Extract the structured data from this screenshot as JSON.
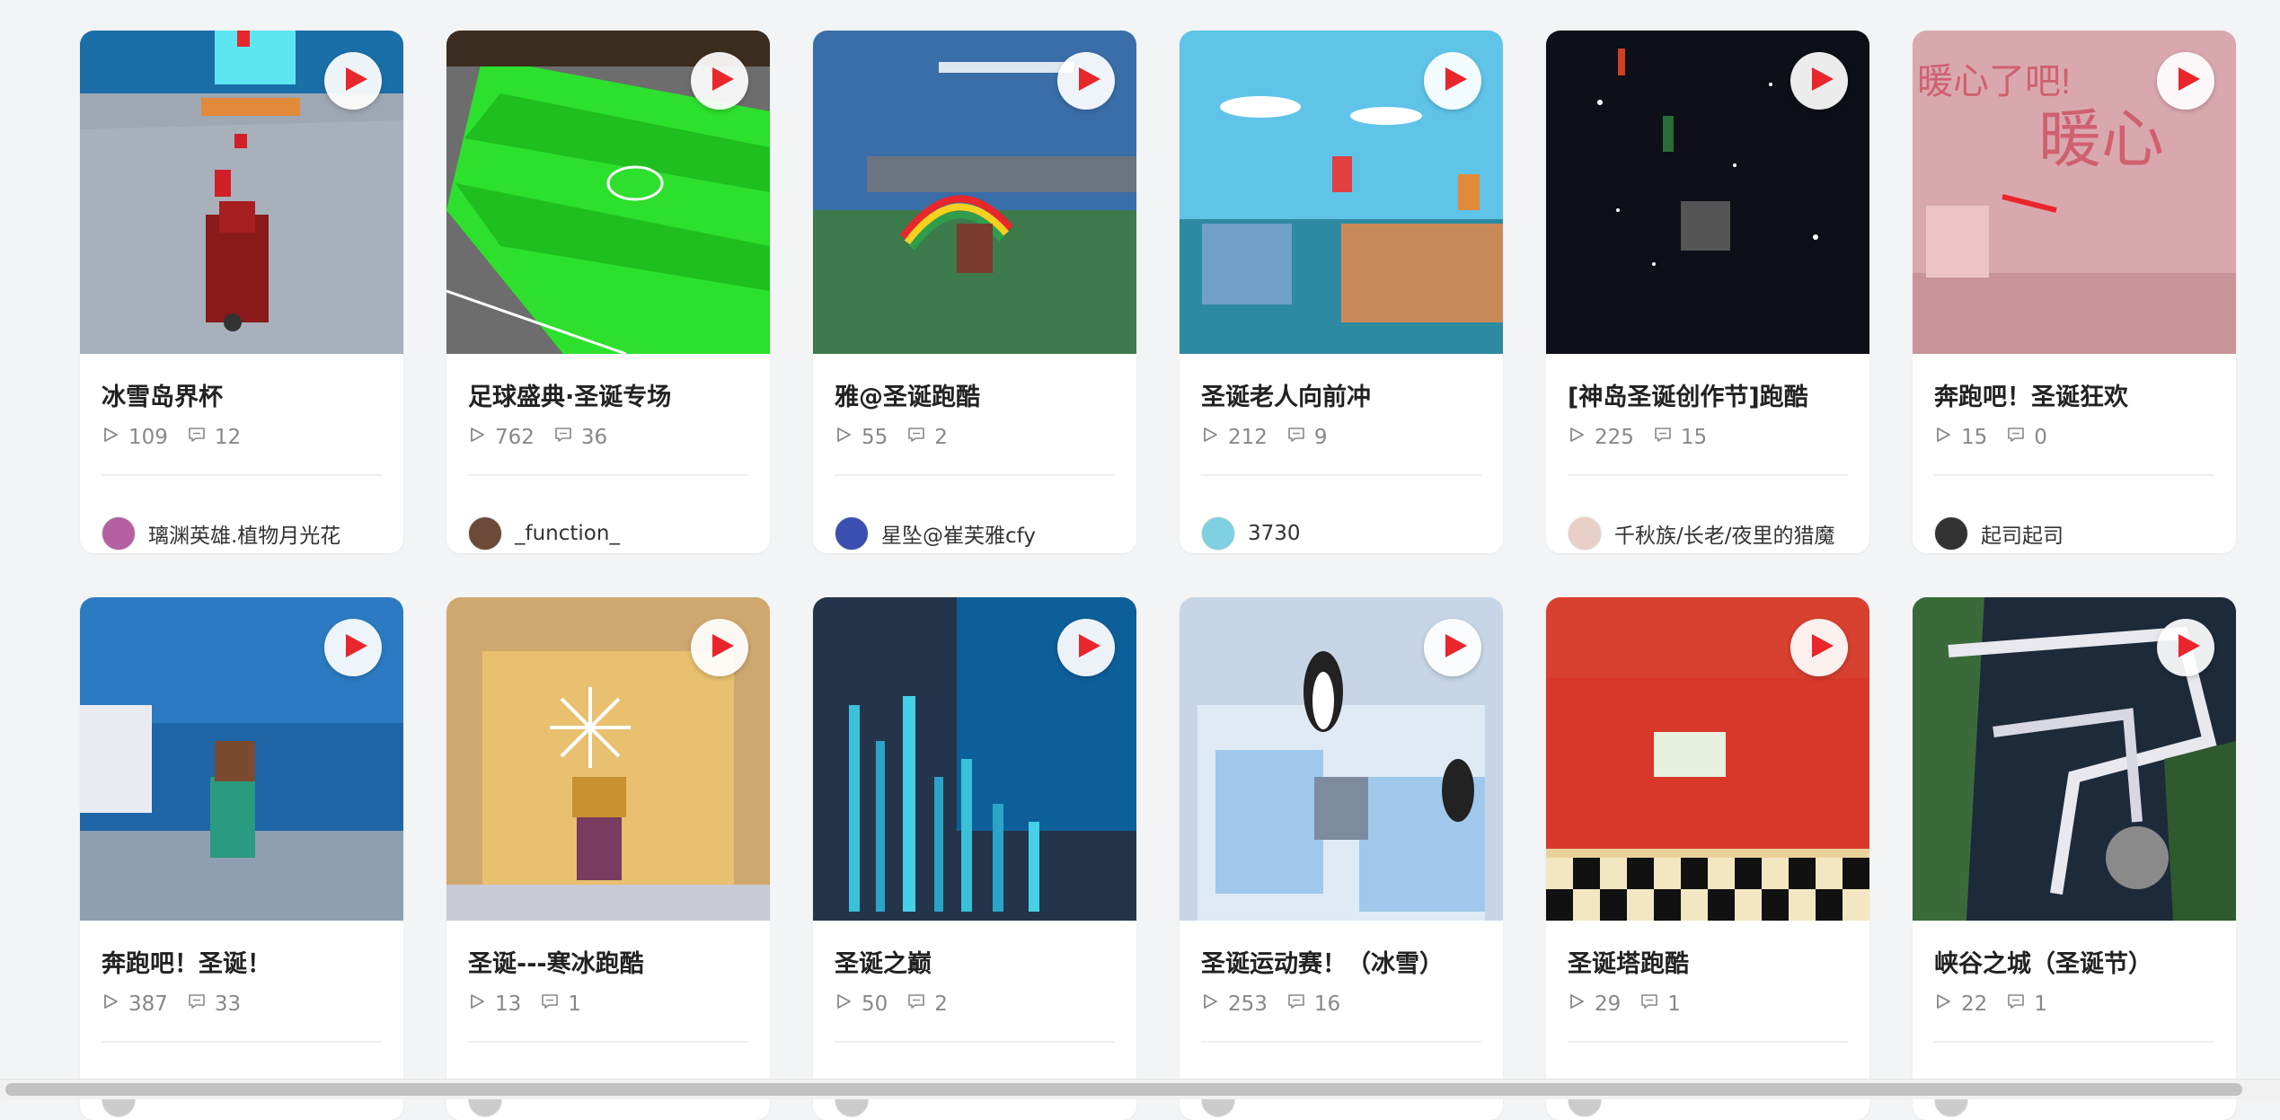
{
  "cards": [
    {
      "title": "冰雪岛界杯",
      "plays": "109",
      "comments": "12",
      "author": "璃渊英雄.植物月光花",
      "avatar_color": "#b45fa0",
      "thumb": "ice"
    },
    {
      "title": "足球盛典·圣诞专场",
      "plays": "762",
      "comments": "36",
      "author": "_function_",
      "avatar_color": "#6b4a3a",
      "thumb": "soccer"
    },
    {
      "title": "雅@圣诞跑酷",
      "plays": "55",
      "comments": "2",
      "author": "星坠@崔芙雅cfy",
      "avatar_color": "#3b4fb0",
      "thumb": "rainbow"
    },
    {
      "title": "圣诞老人向前冲",
      "plays": "212",
      "comments": "9",
      "author": "3730",
      "avatar_color": "#7fd0e0",
      "thumb": "sea"
    },
    {
      "title": "[神岛圣诞创作节]跑酷",
      "plays": "225",
      "comments": "15",
      "author": "千秋族/长老/夜里的猎魔",
      "avatar_color": "#e8d0c8",
      "thumb": "night"
    },
    {
      "title": "奔跑吧！圣诞狂欢",
      "plays": "15",
      "comments": "0",
      "author": "起司起司",
      "avatar_color": "#333333",
      "thumb": "pink"
    },
    {
      "title": "奔跑吧！圣诞！",
      "plays": "387",
      "comments": "33",
      "author": "",
      "avatar_color": "#cccccc",
      "thumb": "ocean"
    },
    {
      "title": "圣诞---寒冰跑酷",
      "plays": "13",
      "comments": "1",
      "author": "",
      "avatar_color": "#cccccc",
      "thumb": "gold"
    },
    {
      "title": "圣诞之巅",
      "plays": "50",
      "comments": "2",
      "author": "",
      "avatar_color": "#cccccc",
      "thumb": "crystal"
    },
    {
      "title": "圣诞运动赛！（冰雪）",
      "plays": "253",
      "comments": "16",
      "author": "",
      "avatar_color": "#cccccc",
      "thumb": "penguin"
    },
    {
      "title": "圣诞塔跑酷",
      "plays": "29",
      "comments": "1",
      "author": "",
      "avatar_color": "#cccccc",
      "thumb": "checker"
    },
    {
      "title": "峡谷之城（圣诞节）",
      "plays": "22",
      "comments": "1",
      "author": "",
      "avatar_color": "#cccccc",
      "thumb": "canyon"
    }
  ],
  "colors": {
    "play_accent": "#e8262b",
    "stat_gray": "#888888"
  },
  "icons": {
    "play": "play-icon",
    "views": "play-count-icon",
    "comments": "comment-icon"
  }
}
